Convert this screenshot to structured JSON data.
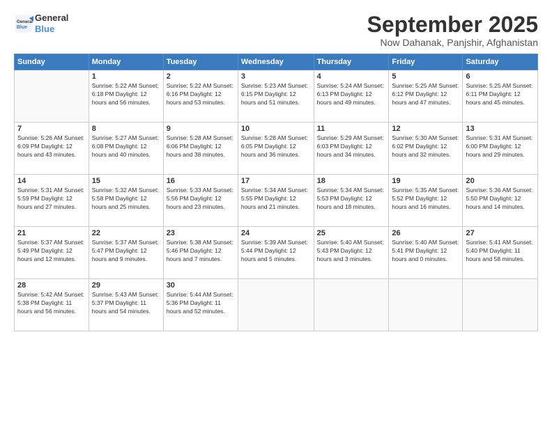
{
  "logo": {
    "line1": "General",
    "line2": "Blue"
  },
  "title": "September 2025",
  "location": "Now Dahanak, Panjshir, Afghanistan",
  "days_header": [
    "Sunday",
    "Monday",
    "Tuesday",
    "Wednesday",
    "Thursday",
    "Friday",
    "Saturday"
  ],
  "weeks": [
    [
      {
        "day": "",
        "info": ""
      },
      {
        "day": "1",
        "info": "Sunrise: 5:22 AM\nSunset: 6:18 PM\nDaylight: 12 hours\nand 56 minutes."
      },
      {
        "day": "2",
        "info": "Sunrise: 5:22 AM\nSunset: 6:16 PM\nDaylight: 12 hours\nand 53 minutes."
      },
      {
        "day": "3",
        "info": "Sunrise: 5:23 AM\nSunset: 6:15 PM\nDaylight: 12 hours\nand 51 minutes."
      },
      {
        "day": "4",
        "info": "Sunrise: 5:24 AM\nSunset: 6:13 PM\nDaylight: 12 hours\nand 49 minutes."
      },
      {
        "day": "5",
        "info": "Sunrise: 5:25 AM\nSunset: 6:12 PM\nDaylight: 12 hours\nand 47 minutes."
      },
      {
        "day": "6",
        "info": "Sunrise: 5:25 AM\nSunset: 6:11 PM\nDaylight: 12 hours\nand 45 minutes."
      }
    ],
    [
      {
        "day": "7",
        "info": "Sunrise: 5:26 AM\nSunset: 6:09 PM\nDaylight: 12 hours\nand 43 minutes."
      },
      {
        "day": "8",
        "info": "Sunrise: 5:27 AM\nSunset: 6:08 PM\nDaylight: 12 hours\nand 40 minutes."
      },
      {
        "day": "9",
        "info": "Sunrise: 5:28 AM\nSunset: 6:06 PM\nDaylight: 12 hours\nand 38 minutes."
      },
      {
        "day": "10",
        "info": "Sunrise: 5:28 AM\nSunset: 6:05 PM\nDaylight: 12 hours\nand 36 minutes."
      },
      {
        "day": "11",
        "info": "Sunrise: 5:29 AM\nSunset: 6:03 PM\nDaylight: 12 hours\nand 34 minutes."
      },
      {
        "day": "12",
        "info": "Sunrise: 5:30 AM\nSunset: 6:02 PM\nDaylight: 12 hours\nand 32 minutes."
      },
      {
        "day": "13",
        "info": "Sunrise: 5:31 AM\nSunset: 6:00 PM\nDaylight: 12 hours\nand 29 minutes."
      }
    ],
    [
      {
        "day": "14",
        "info": "Sunrise: 5:31 AM\nSunset: 5:59 PM\nDaylight: 12 hours\nand 27 minutes."
      },
      {
        "day": "15",
        "info": "Sunrise: 5:32 AM\nSunset: 5:58 PM\nDaylight: 12 hours\nand 25 minutes."
      },
      {
        "day": "16",
        "info": "Sunrise: 5:33 AM\nSunset: 5:56 PM\nDaylight: 12 hours\nand 23 minutes."
      },
      {
        "day": "17",
        "info": "Sunrise: 5:34 AM\nSunset: 5:55 PM\nDaylight: 12 hours\nand 21 minutes."
      },
      {
        "day": "18",
        "info": "Sunrise: 5:34 AM\nSunset: 5:53 PM\nDaylight: 12 hours\nand 18 minutes."
      },
      {
        "day": "19",
        "info": "Sunrise: 5:35 AM\nSunset: 5:52 PM\nDaylight: 12 hours\nand 16 minutes."
      },
      {
        "day": "20",
        "info": "Sunrise: 5:36 AM\nSunset: 5:50 PM\nDaylight: 12 hours\nand 14 minutes."
      }
    ],
    [
      {
        "day": "21",
        "info": "Sunrise: 5:37 AM\nSunset: 5:49 PM\nDaylight: 12 hours\nand 12 minutes."
      },
      {
        "day": "22",
        "info": "Sunrise: 5:37 AM\nSunset: 5:47 PM\nDaylight: 12 hours\nand 9 minutes."
      },
      {
        "day": "23",
        "info": "Sunrise: 5:38 AM\nSunset: 5:46 PM\nDaylight: 12 hours\nand 7 minutes."
      },
      {
        "day": "24",
        "info": "Sunrise: 5:39 AM\nSunset: 5:44 PM\nDaylight: 12 hours\nand 5 minutes."
      },
      {
        "day": "25",
        "info": "Sunrise: 5:40 AM\nSunset: 5:43 PM\nDaylight: 12 hours\nand 3 minutes."
      },
      {
        "day": "26",
        "info": "Sunrise: 5:40 AM\nSunset: 5:41 PM\nDaylight: 12 hours\nand 0 minutes."
      },
      {
        "day": "27",
        "info": "Sunrise: 5:41 AM\nSunset: 5:40 PM\nDaylight: 11 hours\nand 58 minutes."
      }
    ],
    [
      {
        "day": "28",
        "info": "Sunrise: 5:42 AM\nSunset: 5:38 PM\nDaylight: 11 hours\nand 56 minutes."
      },
      {
        "day": "29",
        "info": "Sunrise: 5:43 AM\nSunset: 5:37 PM\nDaylight: 11 hours\nand 54 minutes."
      },
      {
        "day": "30",
        "info": "Sunrise: 5:44 AM\nSunset: 5:36 PM\nDaylight: 11 hours\nand 52 minutes."
      },
      {
        "day": "",
        "info": ""
      },
      {
        "day": "",
        "info": ""
      },
      {
        "day": "",
        "info": ""
      },
      {
        "day": "",
        "info": ""
      }
    ]
  ]
}
